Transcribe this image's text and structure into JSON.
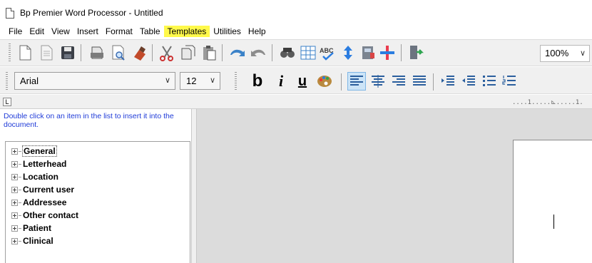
{
  "window": {
    "title": "Bp Premier Word Processor - Untitled"
  },
  "menu": [
    "File",
    "Edit",
    "View",
    "Insert",
    "Format",
    "Table",
    "Templates",
    "Utilities",
    "Help"
  ],
  "highlight_color": "#fff94a",
  "toolbar": {
    "buttons": [
      "new-document-icon",
      "new-from-template-icon",
      "save-icon",
      "print-icon",
      "print-preview-icon",
      "stamp-icon",
      "cut-icon",
      "copy-icon",
      "paste-icon",
      "undo-icon",
      "redo-icon",
      "find-icon",
      "insert-table-icon",
      "spell-check-icon",
      "sort-icon",
      "archive-icon",
      "insert-cross-icon",
      "exit-icon"
    ],
    "zoom": "100%"
  },
  "format_bar": {
    "font": "Arial",
    "size": "12",
    "bold": "b",
    "italic": "i",
    "underline": "u"
  },
  "ruler": {
    "tab_marker": "L",
    "marks": "....1.....⊾.....1."
  },
  "left_panel": {
    "help_text": "Double click on an item in the list to insert it into the document.",
    "tree": [
      "General",
      "Letterhead",
      "Location",
      "Current user",
      "Addressee",
      "Other contact",
      "Patient",
      "Clinical"
    ]
  }
}
